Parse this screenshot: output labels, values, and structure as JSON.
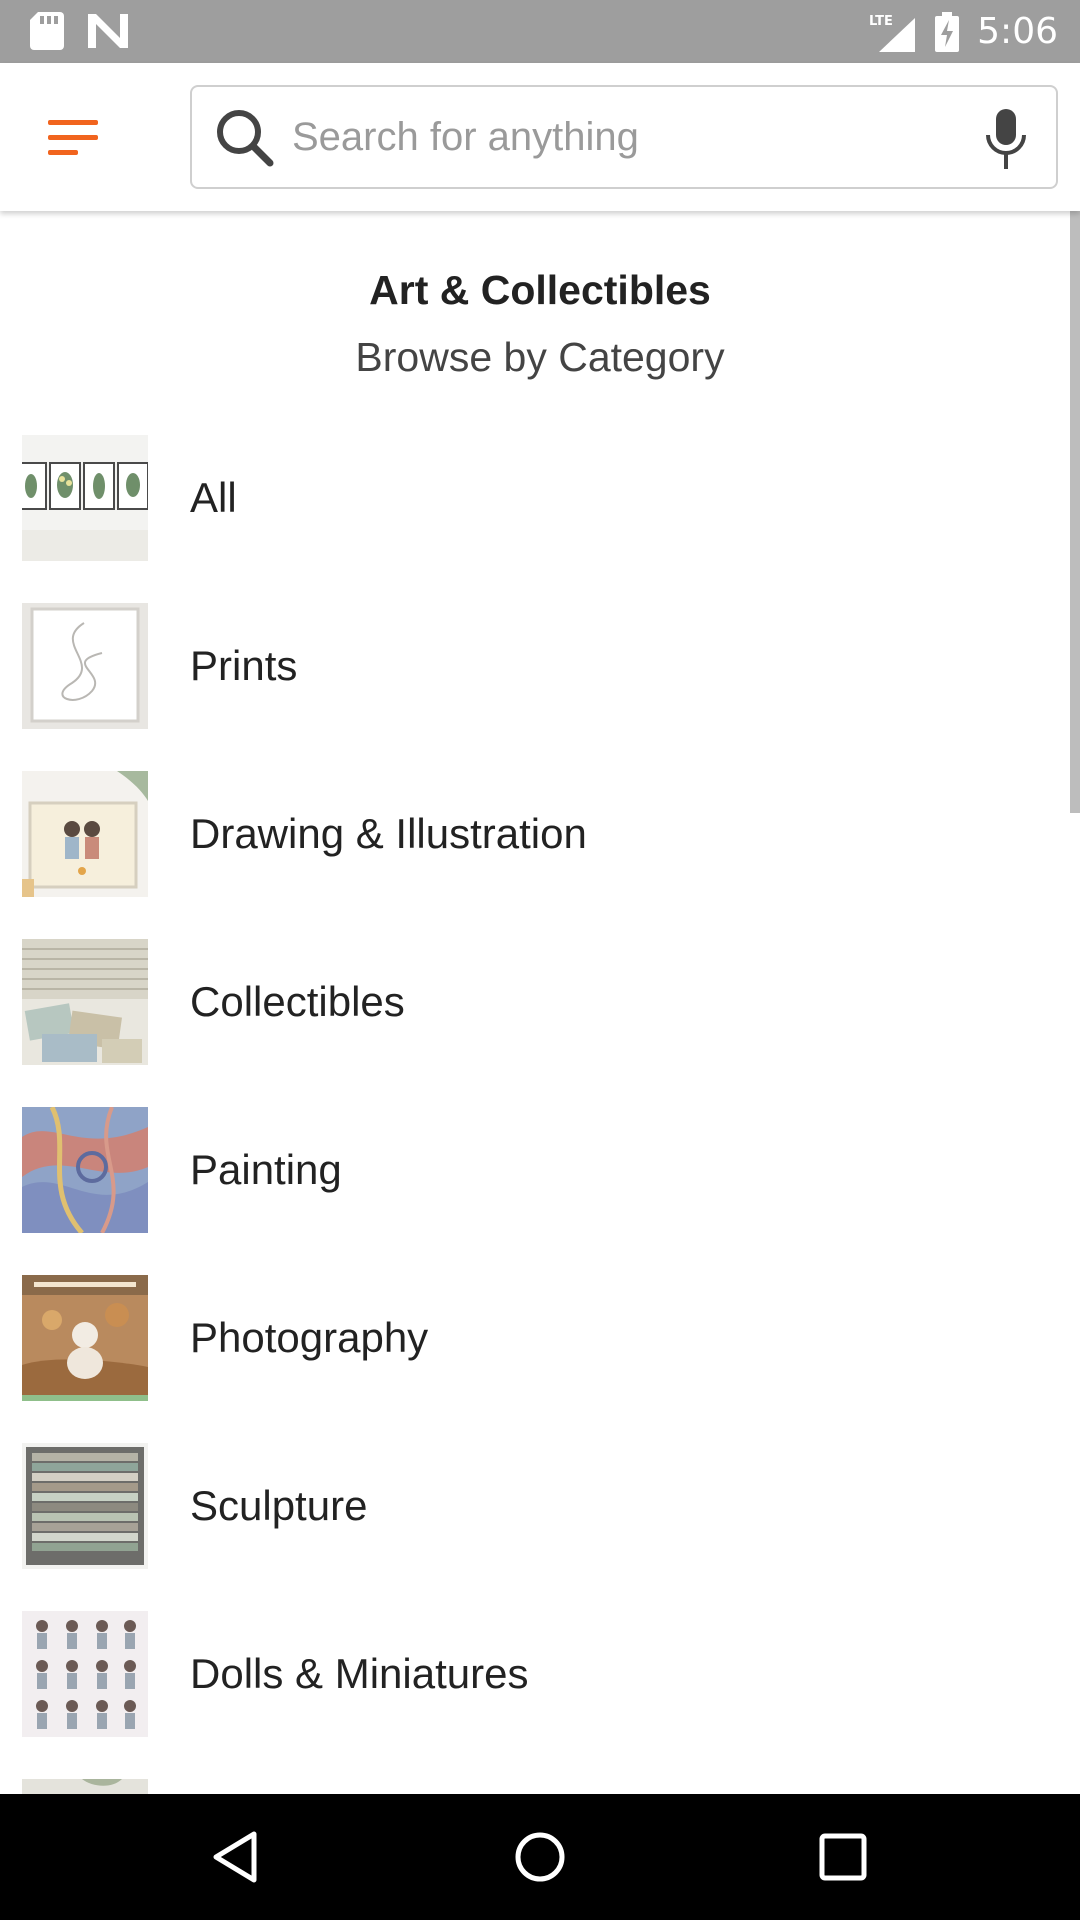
{
  "status_bar": {
    "time": "5:06",
    "network": "LTE",
    "icons": [
      "sd-card-icon",
      "notification-n-icon",
      "lte-signal-icon",
      "battery-charging-icon"
    ]
  },
  "app_bar": {
    "menu_icon": "hamburger-menu-icon",
    "accent_color": "#f1641e",
    "search": {
      "placeholder": "Search for anything",
      "value": ""
    }
  },
  "header": {
    "title": "Art & Collectibles",
    "subtitle": "Browse by Category"
  },
  "categories": [
    {
      "label": "All",
      "thumb_icon": "botanical-prints-thumbnail"
    },
    {
      "label": "Prints",
      "thumb_icon": "line-art-print-thumbnail"
    },
    {
      "label": "Drawing & Illustration",
      "thumb_icon": "couple-illustration-thumbnail"
    },
    {
      "label": "Collectibles",
      "thumb_icon": "postcard-stack-thumbnail"
    },
    {
      "label": "Painting",
      "thumb_icon": "abstract-painting-thumbnail"
    },
    {
      "label": "Photography",
      "thumb_icon": "autumn-photo-thumbnail"
    },
    {
      "label": "Sculpture",
      "thumb_icon": "wood-strip-art-thumbnail"
    },
    {
      "label": "Dolls & Miniatures",
      "thumb_icon": "miniature-figures-thumbnail"
    }
  ],
  "nav_bar": {
    "icons": [
      "back-icon",
      "home-icon",
      "recents-icon"
    ]
  }
}
